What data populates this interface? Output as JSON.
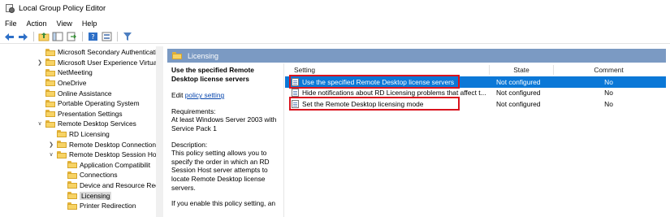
{
  "window": {
    "title": "Local Group Policy Editor"
  },
  "menu": {
    "items": [
      "File",
      "Action",
      "View",
      "Help"
    ]
  },
  "toolbar": {
    "icons": [
      "back-arrow-icon",
      "forward-arrow-icon",
      "up-folder-icon",
      "show-hide-tree-icon",
      "export-list-icon",
      "help-icon",
      "properties-icon",
      "filter-icon"
    ]
  },
  "tree": {
    "items": [
      {
        "label": "Microsoft Secondary Authenticati",
        "expander": "",
        "level": 3
      },
      {
        "label": "Microsoft User Experience Virtua",
        "expander": ">",
        "level": 3
      },
      {
        "label": "NetMeeting",
        "expander": "",
        "level": 3
      },
      {
        "label": "OneDrive",
        "expander": "",
        "level": 3
      },
      {
        "label": "Online Assistance",
        "expander": "",
        "level": 3
      },
      {
        "label": "Portable Operating System",
        "expander": "",
        "level": 3
      },
      {
        "label": "Presentation Settings",
        "expander": "",
        "level": 3
      },
      {
        "label": "Remote Desktop Services",
        "expander": "v",
        "level": 3
      },
      {
        "label": "RD Licensing",
        "expander": "",
        "level": 4
      },
      {
        "label": "Remote Desktop Connection",
        "expander": ">",
        "level": 4
      },
      {
        "label": "Remote Desktop Session Ho",
        "expander": "v",
        "level": 4
      },
      {
        "label": "Application Compatibilit",
        "expander": "",
        "level": 5
      },
      {
        "label": "Connections",
        "expander": "",
        "level": 5
      },
      {
        "label": "Device and Resource Rec",
        "expander": "",
        "level": 5
      },
      {
        "label": "Licensing",
        "expander": "",
        "level": 5,
        "selected": true
      },
      {
        "label": "Printer Redirection",
        "expander": "",
        "level": 5
      }
    ]
  },
  "header": {
    "title": "Licensing"
  },
  "description": {
    "title": "Use the specified Remote Desktop license servers",
    "edit_prefix": "Edit ",
    "edit_link": "policy setting",
    "requirements_label": "Requirements:",
    "requirements_text": "At least Windows Server 2003 with Service Pack 1",
    "description_label": "Description:",
    "description_text": "This policy setting allows you to specify the order in which an RD Session Host server attempts to locate Remote Desktop license servers.",
    "more_text": "If you enable this policy setting, an"
  },
  "table": {
    "columns": [
      "Setting",
      "State",
      "Comment"
    ],
    "rows": [
      {
        "setting": "Use the specified Remote Desktop license servers",
        "state": "Not configured",
        "comment": "No",
        "selected": true,
        "highlighted": true
      },
      {
        "setting": "Hide notifications about RD Licensing problems that affect t...",
        "state": "Not configured",
        "comment": "No",
        "selected": false,
        "highlighted": false
      },
      {
        "setting": "Set the Remote Desktop licensing mode",
        "state": "Not configured",
        "comment": "No",
        "selected": false,
        "highlighted": true
      }
    ]
  },
  "colors": {
    "header_strip": "#7b9ac3",
    "selection": "#0b78d7",
    "highlight_box": "#d9131d",
    "link": "#0645ad"
  }
}
